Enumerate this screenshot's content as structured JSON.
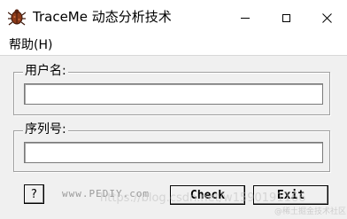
{
  "window": {
    "title": "TraceMe 动态分析技术",
    "icon": "bug-icon"
  },
  "menu": {
    "items": [
      {
        "label": "帮助(H)"
      }
    ]
  },
  "form": {
    "username": {
      "label": "用户名:",
      "value": ""
    },
    "serial": {
      "label": "序列号:",
      "value": ""
    }
  },
  "buttons": {
    "help": "?",
    "check": "Check",
    "exit": "Exit"
  },
  "site_text": "www.PEDIY.com",
  "watermark": "https://blog.csdn.net/w1590191166",
  "watermark_sub": "@稀土掘金技术社区",
  "colors": {
    "background": "#f0f0f0",
    "titlebar": "#ffffff",
    "border": "#a0a0a0"
  }
}
